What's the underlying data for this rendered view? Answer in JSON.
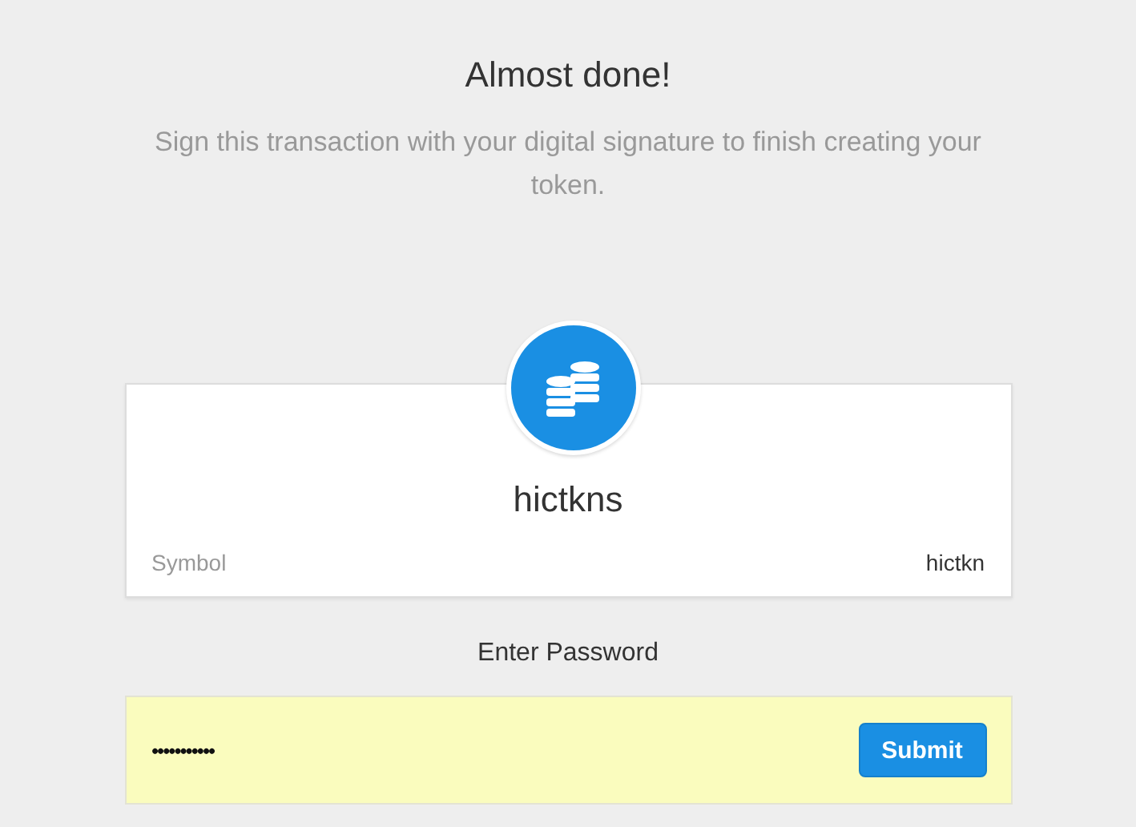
{
  "heading": "Almost done!",
  "subtitle": "Sign this transaction with your digital signature to finish creating your token.",
  "token": {
    "name": "hictkns",
    "symbol_label": "Symbol",
    "symbol": "hictkn"
  },
  "password": {
    "label": "Enter Password",
    "value": "•••••••••••"
  },
  "submit": "Submit"
}
